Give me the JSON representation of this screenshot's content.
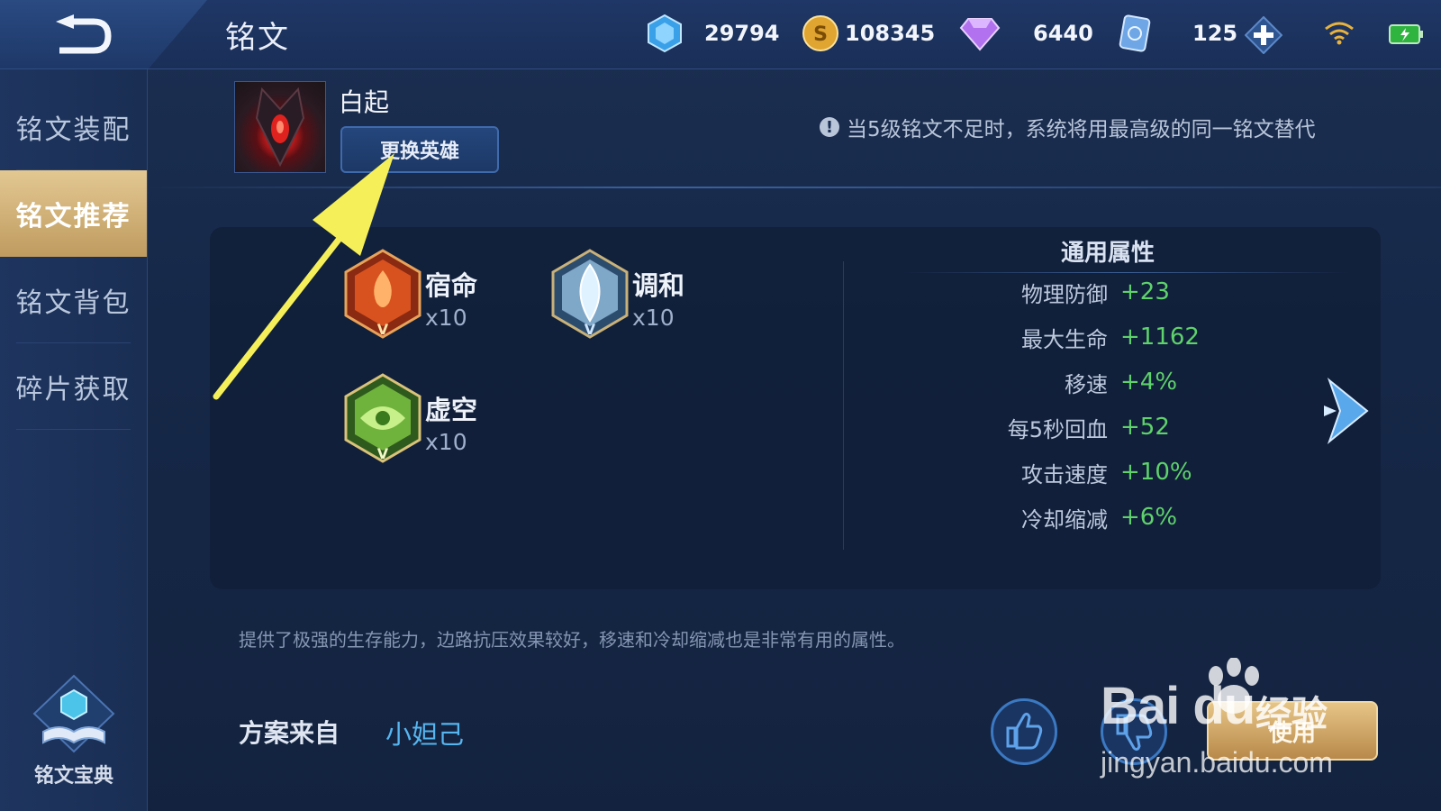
{
  "header": {
    "title": "铭文",
    "currencies": [
      {
        "name": "diamond",
        "icon": "blue-crystal-icon",
        "value": "29794"
      },
      {
        "name": "gold",
        "icon": "gold-coin-icon",
        "value": "108345"
      },
      {
        "name": "gems",
        "icon": "purple-gem-icon",
        "value": "6440"
      },
      {
        "name": "coupons",
        "icon": "voucher-icon",
        "value": "125"
      }
    ]
  },
  "sidebar": {
    "items": [
      {
        "label": "铭文装配",
        "active": false
      },
      {
        "label": "铭文推荐",
        "active": true
      },
      {
        "label": "铭文背包",
        "active": false
      },
      {
        "label": "碎片获取",
        "active": false
      }
    ],
    "codex_label": "铭文宝典"
  },
  "hero": {
    "name": "白起",
    "switch_label": "更换英雄"
  },
  "notice": "当5级铭文不足时，系统将用最高级的同一铭文替代",
  "inscriptions": [
    {
      "name": "宿命",
      "count": "x10",
      "color": "red"
    },
    {
      "name": "调和",
      "count": "x10",
      "color": "blue"
    },
    {
      "name": "虚空",
      "count": "x10",
      "color": "green"
    }
  ],
  "attributes": {
    "title": "通用属性",
    "rows": [
      {
        "name": "物理防御",
        "value": "+23"
      },
      {
        "name": "最大生命",
        "value": "+1162"
      },
      {
        "name": "移速",
        "value": "+4%"
      },
      {
        "name": "每5秒回血",
        "value": "+52"
      },
      {
        "name": "攻击速度",
        "value": "+10%"
      },
      {
        "name": "冷却缩减",
        "value": "+6%"
      }
    ]
  },
  "description": "提供了极强的生存能力，边路抗压效果较好，移速和冷却缩减也是非常有用的属性。",
  "source": {
    "label": "方案来自",
    "author": "小妲己"
  },
  "actions": {
    "use_label": "使用"
  },
  "watermark": {
    "brand": "Bai du",
    "suffix": "经验",
    "url": "jingyan.baidu.com"
  },
  "colors": {
    "attr_value": "#5ed26b",
    "author_link": "#56b5ef",
    "active_tab": "#d6b77a",
    "annotation_arrow": "#f5f05a"
  }
}
